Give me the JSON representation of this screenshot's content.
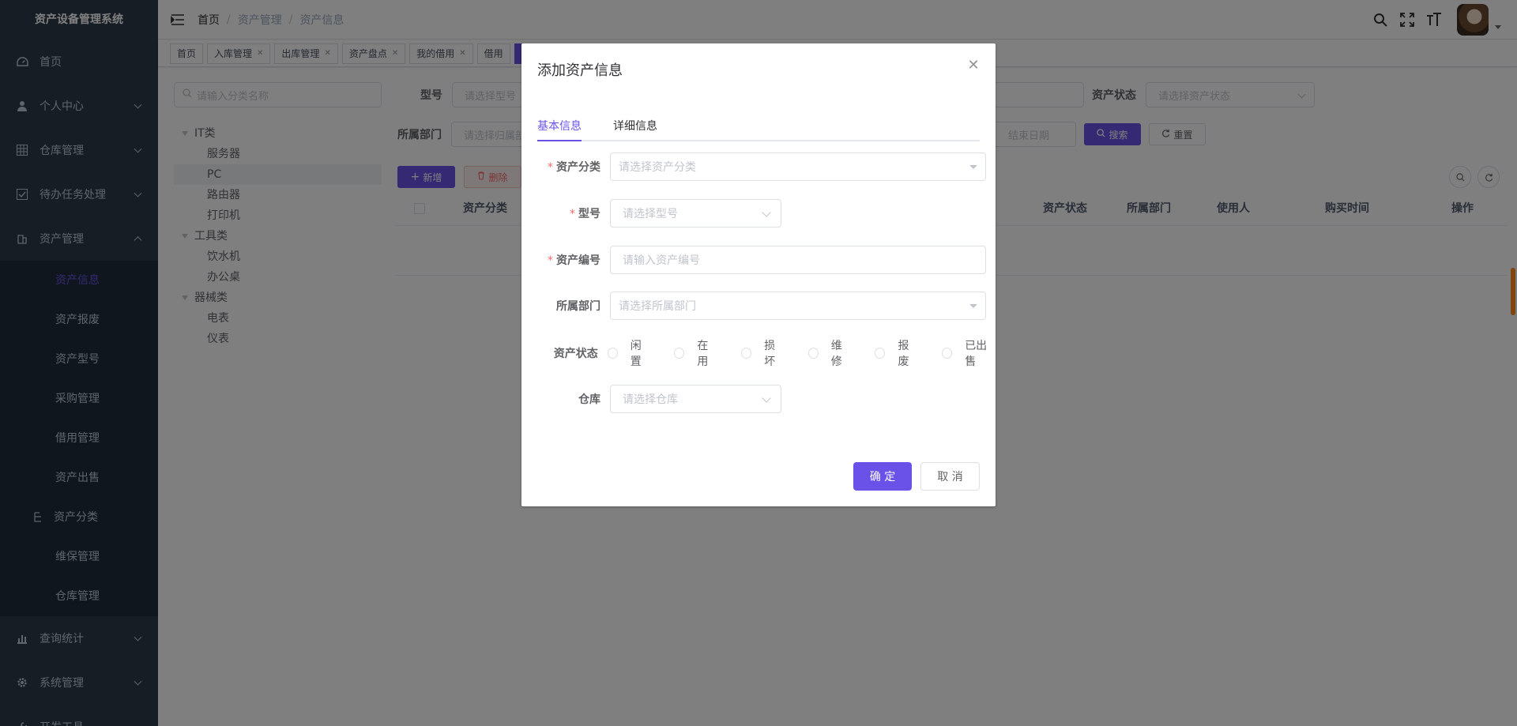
{
  "app": {
    "title": "资产设备管理系统"
  },
  "sidebar": {
    "menu": [
      {
        "label": "首页"
      },
      {
        "label": "个人中心"
      },
      {
        "label": "仓库管理"
      },
      {
        "label": "待办任务处理"
      },
      {
        "label": "资产管理"
      }
    ],
    "asset_sub": [
      {
        "label": "资产信息"
      },
      {
        "label": "资产报废"
      },
      {
        "label": "资产型号"
      },
      {
        "label": "采购管理"
      },
      {
        "label": "借用管理"
      },
      {
        "label": "资产出售"
      },
      {
        "label": "资产分类"
      },
      {
        "label": "维保管理"
      },
      {
        "label": "仓库管理"
      }
    ],
    "menu_after": [
      {
        "label": "查询统计"
      },
      {
        "label": "系统管理"
      },
      {
        "label": "开发工具"
      }
    ]
  },
  "breadcrumb": [
    "首页",
    "资产管理",
    "资产信息"
  ],
  "tags": [
    "首页",
    "入库管理",
    "出库管理",
    "资产盘点",
    "我的借用",
    "借用"
  ],
  "tree": {
    "search_placeholder": "请输入分类名称",
    "nodes": [
      {
        "label": "IT类",
        "level": 1
      },
      {
        "label": "服务器",
        "level": 2
      },
      {
        "label": "PC",
        "level": 2
      },
      {
        "label": "路由器",
        "level": 2
      },
      {
        "label": "打印机",
        "level": 2
      },
      {
        "label": "工具类",
        "level": 1
      },
      {
        "label": "饮水机",
        "level": 2
      },
      {
        "label": "办公桌",
        "level": 2
      },
      {
        "label": "器械类",
        "level": 1
      },
      {
        "label": "电表",
        "level": 2
      },
      {
        "label": "仪表",
        "level": 2
      }
    ]
  },
  "filters": {
    "model_label": "型号",
    "model_placeholder": "请选择型号",
    "status_label": "资产状态",
    "status_placeholder": "请选择资产状态",
    "dept_label": "所属部门",
    "dept_placeholder": "请选择归属部",
    "end_date_placeholder": "结束日期",
    "search_btn": "搜索",
    "reset_btn": "重置"
  },
  "toolbar": {
    "add": "新增",
    "delete": "删除"
  },
  "table": {
    "headers": [
      "资产分类",
      "资产状态",
      "所属部门",
      "使用人",
      "购买时间",
      "操作"
    ]
  },
  "dialog": {
    "title": "添加资产信息",
    "tabs": [
      "基本信息",
      "详细信息"
    ],
    "fields": {
      "category": {
        "label": "资产分类",
        "placeholder": "请选择资产分类"
      },
      "model": {
        "label": "型号",
        "placeholder": "请选择型号"
      },
      "code": {
        "label": "资产编号",
        "placeholder": "请输入资产编号"
      },
      "dept": {
        "label": "所属部门",
        "placeholder": "请选择所属部门"
      },
      "status": {
        "label": "资产状态",
        "options": [
          "闲置",
          "在用",
          "损坏",
          "维修",
          "报废",
          "已出售"
        ]
      },
      "warehouse": {
        "label": "仓库",
        "placeholder": "请选择仓库"
      }
    },
    "ok": "确 定",
    "cancel": "取 消"
  },
  "colors": {
    "primary": "#6a52e8",
    "sidebar_bg": "#2d3a4b",
    "submenu_bg": "#1f2d3d",
    "danger": "#f56c6c"
  }
}
